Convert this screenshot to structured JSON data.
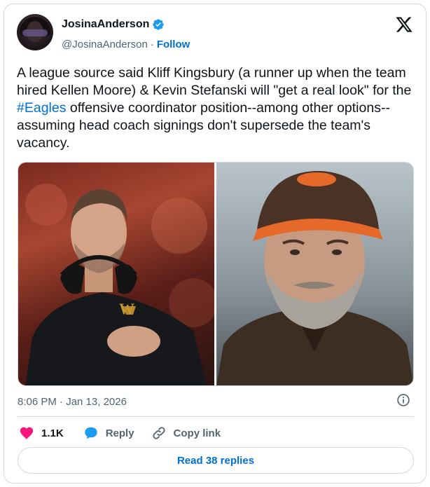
{
  "author": {
    "display_name": "JosinaAnderson",
    "handle": "@JosinaAnderson",
    "separator": "·",
    "follow_label": "Follow",
    "verified_color": "#1d9bf0"
  },
  "tweet": {
    "text_parts": [
      "A league source said Kliff Kingsbury (a runner up when the team hired Kellen Moore) & Kevin Stefanski will \"get a real look\" for the ",
      "#Eagles",
      " offensive coordinator position--among other options--assuming head coach signings don't supersede the team's vacancy."
    ],
    "timestamp": "8:06 PM · Jan 13, 2026"
  },
  "media": {
    "photos": [
      {
        "description_icon": "person-photo",
        "accent": "#7a2a20"
      },
      {
        "description_icon": "person-photo",
        "accent": "#8b969c"
      }
    ]
  },
  "actions": {
    "like_count": "1.1K",
    "reply_label": "Reply",
    "copy_link_label": "Copy link",
    "read_replies_label": "Read 38 replies"
  },
  "colors": {
    "accent_blue": "#006fd6",
    "like_pink": "#f91880",
    "reply_blue": "#1d9bf0",
    "muted_text": "#536471",
    "border": "#cfd9de"
  }
}
